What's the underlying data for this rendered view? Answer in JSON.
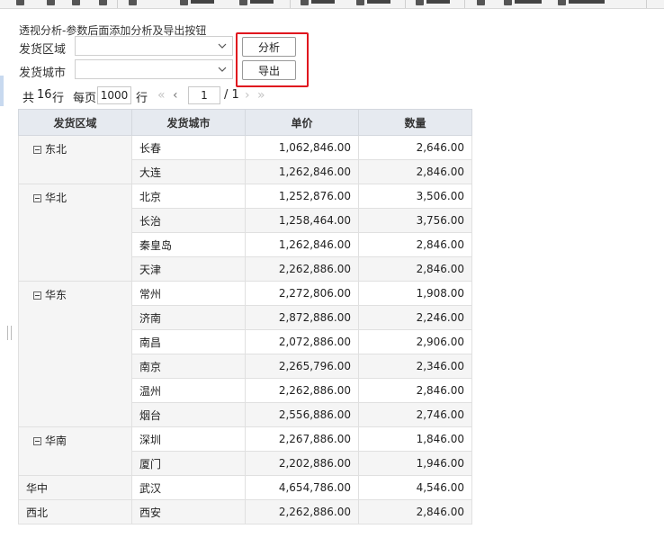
{
  "report": {
    "description": "透视分析-参数后面添加分析及导出按钮"
  },
  "params": [
    {
      "label": "发货区域",
      "value": ""
    },
    {
      "label": "发货城市",
      "value": ""
    }
  ],
  "buttons": {
    "analyze": "分析",
    "export": "导出"
  },
  "pager": {
    "total_prefix": "共",
    "total_count": "16",
    "total_suffix": "行",
    "per_page_label": "每页",
    "per_page_value": "1000",
    "per_page_suffix": "行",
    "current_page": "1",
    "total_pages": "/ 1"
  },
  "table": {
    "headers": [
      "发货区域",
      "发货城市",
      "单价",
      "数量"
    ],
    "groups": [
      {
        "region": "东北",
        "collapsible": true,
        "rows": [
          {
            "city": "长春",
            "price": "1,062,846.00",
            "qty": "2,646.00"
          },
          {
            "city": "大连",
            "price": "1,262,846.00",
            "qty": "2,846.00"
          }
        ]
      },
      {
        "region": "华北",
        "collapsible": true,
        "rows": [
          {
            "city": "北京",
            "price": "1,252,876.00",
            "qty": "3,506.00"
          },
          {
            "city": "长治",
            "price": "1,258,464.00",
            "qty": "3,756.00"
          },
          {
            "city": "秦皇岛",
            "price": "1,262,846.00",
            "qty": "2,846.00"
          },
          {
            "city": "天津",
            "price": "2,262,886.00",
            "qty": "2,846.00"
          }
        ]
      },
      {
        "region": "华东",
        "collapsible": true,
        "rows": [
          {
            "city": "常州",
            "price": "2,272,806.00",
            "qty": "1,908.00"
          },
          {
            "city": "济南",
            "price": "2,872,886.00",
            "qty": "2,246.00"
          },
          {
            "city": "南昌",
            "price": "2,072,886.00",
            "qty": "2,906.00"
          },
          {
            "city": "南京",
            "price": "2,265,796.00",
            "qty": "2,346.00"
          },
          {
            "city": "温州",
            "price": "2,262,886.00",
            "qty": "2,846.00"
          },
          {
            "city": "烟台",
            "price": "2,556,886.00",
            "qty": "2,746.00"
          }
        ]
      },
      {
        "region": "华南",
        "collapsible": true,
        "rows": [
          {
            "city": "深圳",
            "price": "2,267,886.00",
            "qty": "1,846.00"
          },
          {
            "city": "厦门",
            "price": "2,202,886.00",
            "qty": "1,946.00"
          }
        ]
      },
      {
        "region": "华中",
        "collapsible": false,
        "rows": [
          {
            "city": "武汉",
            "price": "4,654,786.00",
            "qty": "4,546.00"
          }
        ]
      },
      {
        "region": "西北",
        "collapsible": false,
        "rows": [
          {
            "city": "西安",
            "price": "2,262,886.00",
            "qty": "2,846.00"
          }
        ]
      }
    ]
  },
  "colors": {
    "highlight": "#e0141e",
    "header_bg": "#e6eaf0",
    "stripe": "#f5f5f5"
  }
}
